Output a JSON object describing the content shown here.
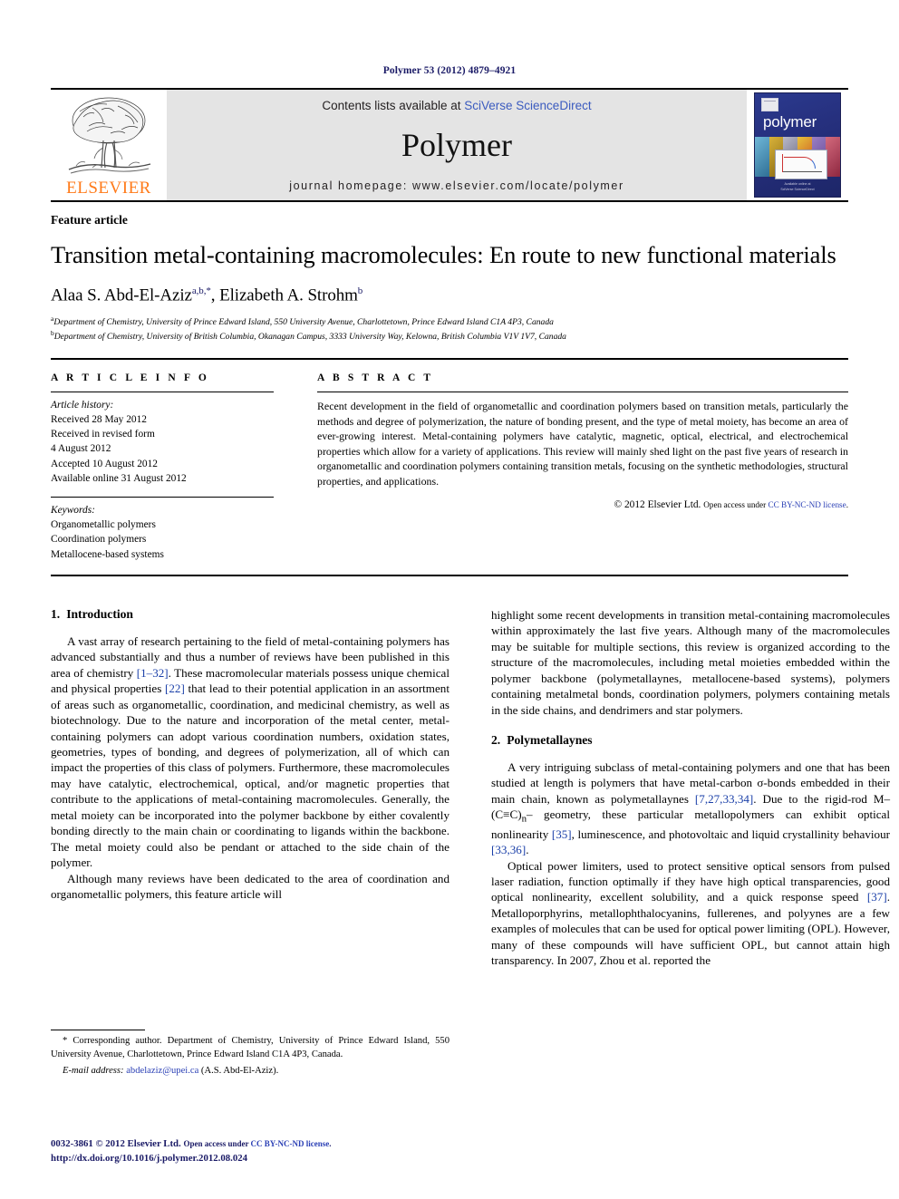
{
  "running_head": "Polymer 53 (2012) 4879–4921",
  "masthead": {
    "contents_prefix": "Contents lists available at ",
    "contents_link": "SciVerse ScienceDirect",
    "journal_name": "Polymer",
    "homepage_label": "journal homepage: www.elsevier.com/locate/polymer",
    "publisher": "ELSEVIER",
    "cover_title": "polymer",
    "cover_footer_line1": "Available online at",
    "cover_footer_line2": "SciVerse ScienceDirect"
  },
  "article": {
    "type": "Feature article",
    "title": "Transition metal-containing macromolecules: En route to new functional materials",
    "author1": "Alaa S. Abd-El-Aziz",
    "author1_sup": "a,b,",
    "author1_star": "*",
    "author_sep": ", ",
    "author2": "Elizabeth A. Strohm",
    "author2_sup": "b",
    "affiliation_a_sup": "a",
    "affiliation_a": "Department of Chemistry, University of Prince Edward Island, 550 University Avenue, Charlottetown, Prince Edward Island C1A 4P3, Canada",
    "affiliation_b_sup": "b",
    "affiliation_b": "Department of Chemistry, University of British Columbia, Okanagan Campus, 3333 University Way, Kelowna, British Columbia V1V 1V7, Canada"
  },
  "info": {
    "heading": "A R T I C L E  I N F O",
    "history_label": "Article history:",
    "history": [
      "Received 28 May 2012",
      "Received in revised form",
      "4 August 2012",
      "Accepted 10 August 2012",
      "Available online 31 August 2012"
    ],
    "keywords_label": "Keywords:",
    "keywords": [
      "Organometallic polymers",
      "Coordination polymers",
      "Metallocene-based systems"
    ]
  },
  "abstract": {
    "heading": "A B S T R A C T",
    "text": "Recent development in the field of organometallic and coordination polymers based on transition metals, particularly the methods and degree of polymerization, the nature of bonding present, and the type of metal moiety, has become an area of ever-growing interest. Metal-containing polymers have catalytic, magnetic, optical, electrical, and electrochemical properties which allow for a variety of applications. This review will mainly shed light on the past five years of research in organometallic and coordination polymers containing transition metals, focusing on the synthetic methodologies, structural properties, and applications.",
    "copyright": "© 2012 Elsevier Ltd.",
    "access_note": "Open access under ",
    "license": "CC BY-NC-ND license",
    "license_tail": "."
  },
  "body": {
    "section1_num": "1.",
    "section1_title": "Introduction",
    "p1_a": "A vast array of research pertaining to the field of metal-containing polymers has advanced substantially and thus a number of reviews have been published in this area of chemistry ",
    "p1_ref1": "[1–32]",
    "p1_b": ". These macromolecular materials possess unique chemical and physical properties ",
    "p1_ref2": "[22]",
    "p1_c": " that lead to their potential application in an assortment of areas such as organometallic, coordination, and medicinal chemistry, as well as biotechnology. Due to the nature and incorporation of the metal center, metal-containing polymers can adopt various coordination numbers, oxidation states, geometries, types of bonding, and degrees of polymerization, all of which can impact the properties of this class of polymers. Furthermore, these macromolecules may have catalytic, electrochemical, optical, and/or magnetic properties that contribute to the applications of metal-containing macromolecules. Generally, the metal moiety can be incorporated into the polymer backbone by either covalently bonding directly to the main chain or coordinating to ligands within the backbone. The metal moiety could also be pendant or attached to the side chain of the polymer.",
    "p2": "Although many reviews have been dedicated to the area of coordination and organometallic polymers, this feature article will",
    "p3": "highlight some recent developments in transition metal-containing macromolecules within approximately the last five years. Although many of the macromolecules may be suitable for multiple sections, this review is organized according to the structure of the macromolecules, including metal moieties embedded within the polymer backbone (polymetallaynes, metallocene-based systems), polymers containing metalmetal bonds, coordination polymers, polymers containing metals in the side chains, and dendrimers and star polymers.",
    "section2_num": "2.",
    "section2_title": "Polymetallaynes",
    "p4_a": "A very intriguing subclass of metal-containing polymers and one that has been studied at length is polymers that have metal-carbon σ-bonds embedded in their main chain, known as polymetallaynes ",
    "p4_ref1": "[7,27,33,34]",
    "p4_b": ". Due to the rigid-rod M–(C≡C)",
    "p4_sub": "n",
    "p4_c": "– geometry, these particular metallopolymers can exhibit optical nonlinearity ",
    "p4_ref2": "[35]",
    "p4_d": ", luminescence, and photovoltaic and liquid crystallinity behaviour ",
    "p4_ref3": "[33,36]",
    "p4_e": ".",
    "p5_a": "Optical power limiters, used to protect sensitive optical sensors from pulsed laser radiation, function optimally if they have high optical transparencies, good optical nonlinearity, excellent solubility, and a quick response speed ",
    "p5_ref1": "[37]",
    "p5_b": ". Metalloporphyrins, metallophthalocyanins, fullerenes, and polyynes are a few examples of molecules that can be used for optical power limiting (OPL). However, many of these compounds will have sufficient OPL, but cannot attain high transparency. In 2007, Zhou et al. reported the"
  },
  "footnote": {
    "star": "*",
    "corresponding": " Corresponding author. Department of Chemistry, University of Prince Edward Island, 550 University Avenue, Charlottetown, Prince Edward Island C1A 4P3, Canada.",
    "email_label": "E-mail address:",
    "email": "abdelaziz@upei.ca",
    "email_attrib": " (A.S. Abd-El-Aziz)."
  },
  "page_footer": {
    "issn": "0032-3861",
    "copyright": "© 2012 Elsevier Ltd.",
    "access_note": "Open access under ",
    "license": "CC BY-NC-ND license",
    "license_tail": ".",
    "doi": "http://dx.doi.org/10.1016/j.polymer.2012.08.024"
  },
  "colors": {
    "link_blue": "#2a3fb5",
    "ref_blue": "#1a3fa8",
    "navy": "#1a1a66",
    "elsevier_orange": "#ff7a19",
    "masthead_gray": "#e4e4e4"
  }
}
